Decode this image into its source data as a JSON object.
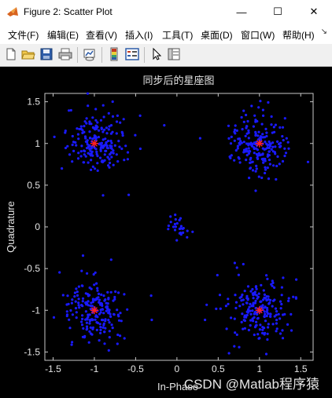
{
  "window": {
    "title": "Figure 2: Scatter Plot",
    "minimize_glyph": "—",
    "maximize_glyph": "☐",
    "close_glyph": "✕"
  },
  "menu": {
    "items": [
      {
        "label": "文件(F)"
      },
      {
        "label": "编辑(E)"
      },
      {
        "label": "查看(V)"
      },
      {
        "label": "插入(I)"
      },
      {
        "label": "工具(T)"
      },
      {
        "label": "桌面(D)"
      },
      {
        "label": "窗口(W)"
      },
      {
        "label": "帮助(H)"
      }
    ],
    "overflow_glyph": "↘"
  },
  "toolbar": {
    "icons": [
      "new-figure-icon",
      "open-folder-icon",
      "save-icon",
      "print-icon",
      "link-plot-icon",
      "colorbar-icon",
      "legend-icon",
      "pointer-icon",
      "property-inspector-icon"
    ]
  },
  "watermark": "CSDN @Matlab程序猿",
  "chart_data": {
    "type": "scatter",
    "title": "同步后的星座图",
    "xlabel": "In-Phase",
    "ylabel": "Quadrature",
    "xlim": [
      -1.6,
      1.65
    ],
    "ylim": [
      -1.6,
      1.6
    ],
    "xticks": [
      "-1.5",
      "-1",
      "-0.5",
      "0",
      "0.5",
      "1",
      "1.5"
    ],
    "yticks": [
      "1.5",
      "1",
      "0.5",
      "0",
      "-0.5",
      "-1",
      "-1.5"
    ],
    "xtick_values": [
      -1.5,
      -1,
      -0.5,
      0,
      0.5,
      1,
      1.5
    ],
    "ytick_values": [
      1.5,
      1,
      0.5,
      0,
      -0.5,
      -1,
      -1.5
    ],
    "grid": false,
    "background": "#000000",
    "axes_color": "#c8c8c8",
    "series": [
      {
        "marker": "dot",
        "color": "#1a1aff",
        "approximate_points_per_cluster": 200,
        "clusters": [
          {
            "x": 1,
            "y": 1
          },
          {
            "x": -1,
            "y": 1
          },
          {
            "x": -1,
            "y": -1
          },
          {
            "x": 1,
            "y": -1
          },
          {
            "x": 0,
            "y": 0
          }
        ]
      },
      {
        "marker": "star",
        "color": "#ff2020",
        "x": [
          1,
          -1,
          -1,
          1
        ],
        "y": [
          1,
          1,
          -1,
          -1
        ]
      }
    ]
  }
}
